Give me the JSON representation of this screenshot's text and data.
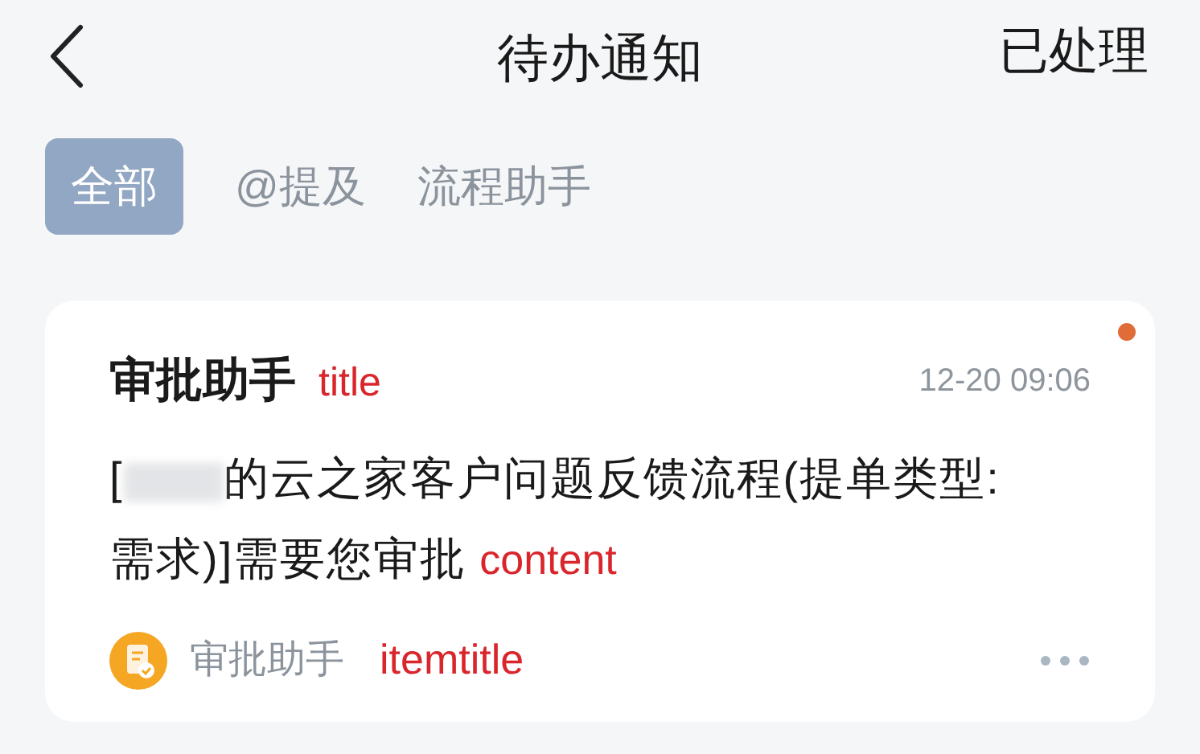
{
  "header": {
    "title": "待办通知",
    "action": "已处理"
  },
  "tabs": [
    {
      "label": "全部",
      "selected": true
    },
    {
      "label": "@提及",
      "selected": false
    },
    {
      "label": "流程助手",
      "selected": false
    }
  ],
  "notifications": [
    {
      "title": "审批助手",
      "title_annotation": "title",
      "time": "12-20 09:06",
      "unread": true,
      "content_prefix": "[",
      "content_lines": [
        "的云之家客户问题反馈流程(提单类型:",
        "需求)]需要您审批"
      ],
      "content_annotation": "content",
      "source": "审批助手",
      "source_annotation": "itemtitle"
    }
  ]
}
